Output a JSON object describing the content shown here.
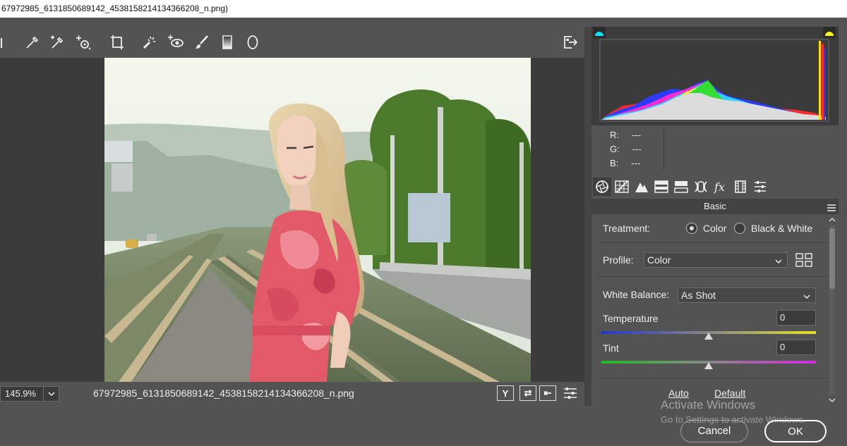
{
  "window": {
    "title": "67972985_6131850689142_4538158214134366208_n.png)"
  },
  "toolbar": {
    "tools": [
      "hand-icon",
      "white-balance-eyedropper-icon",
      "color-sampler-icon",
      "targeted-adjustment-icon",
      "transform-crop-icon",
      "spot-removal-icon",
      "red-eye-icon",
      "adjustment-brush-icon",
      "graduated-filter-icon",
      "radial-filter-icon"
    ],
    "open_object_icon": "open-in-photoshop-icon"
  },
  "status": {
    "zoom": "145.9%",
    "filename": "67972985_6131850689142_4538158214134366208_n.png",
    "buttons": [
      "Y",
      "⇄",
      "⇤"
    ]
  },
  "histogram": {
    "shadow_clip": "#00e5ff",
    "highlight_clip": "#ffff00"
  },
  "readout": {
    "r_label": "R:",
    "r_value": "---",
    "g_label": "G:",
    "g_value": "---",
    "b_label": "B:",
    "b_value": "---"
  },
  "panel_tabs": [
    "basic-icon",
    "tone-curve-icon",
    "detail-icon",
    "hsl-icon",
    "split-toning-icon",
    "lens-corrections-icon",
    "effects-icon",
    "camera-calibration-icon",
    "presets-icon"
  ],
  "basic": {
    "title": "Basic",
    "treatment_label": "Treatment:",
    "treatment_color": "Color",
    "treatment_bw": "Black & White",
    "treatment_selected": "Color",
    "profile_label": "Profile:",
    "profile_value": "Color",
    "wb_label": "White Balance:",
    "wb_value": "As Shot",
    "temperature_label": "Temperature",
    "temperature_value": "0",
    "tint_label": "Tint",
    "tint_value": "0",
    "auto_link": "Auto",
    "default_link": "Default"
  },
  "dialog": {
    "cancel": "Cancel",
    "ok": "OK"
  },
  "watermark": {
    "line1": "Activate Windows",
    "line2": "Go to Settings to activate Windows."
  },
  "colors": {
    "panel_bg": "#535353",
    "canvas_bg": "#3b3b3b",
    "ok_border": "#ffffff"
  }
}
